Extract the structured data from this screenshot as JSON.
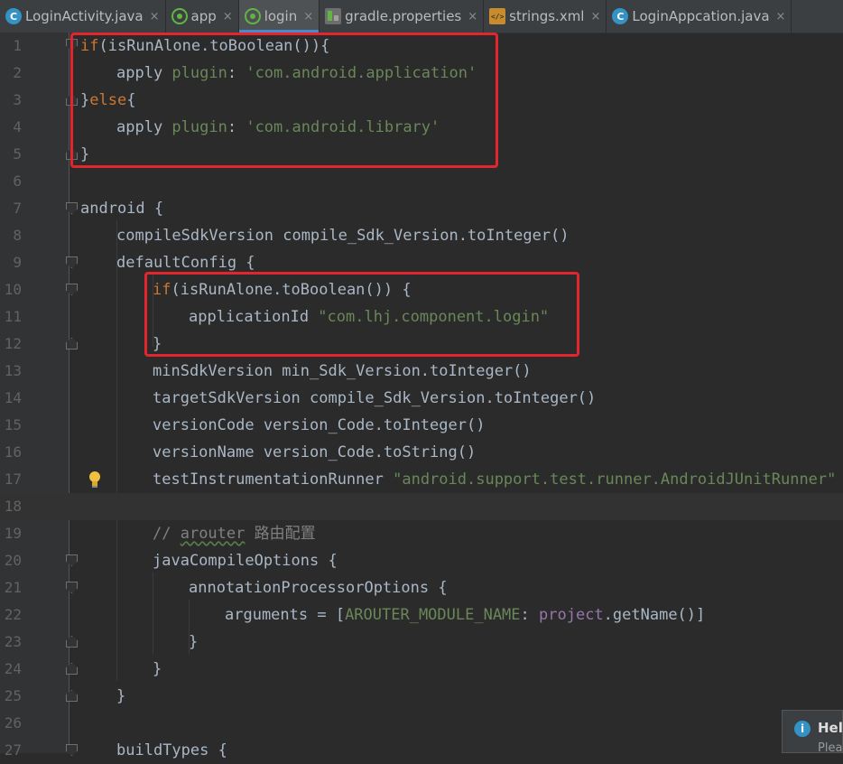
{
  "tabs": [
    {
      "label": "LoginActivity.java",
      "icon": "java-class-icon",
      "active": false
    },
    {
      "label": "app",
      "icon": "gradle-icon",
      "active": false
    },
    {
      "label": "login",
      "icon": "gradle-icon",
      "active": true
    },
    {
      "label": "gradle.properties",
      "icon": "properties-file-icon",
      "active": false
    },
    {
      "label": "strings.xml",
      "icon": "xml-file-icon",
      "active": false
    },
    {
      "label": "LoginAppcation.java",
      "icon": "java-class-icon",
      "active": false
    }
  ],
  "tab_close_glyph": "×",
  "line_numbers": [
    "1",
    "2",
    "3",
    "4",
    "5",
    "6",
    "7",
    "8",
    "9",
    "10",
    "11",
    "12",
    "13",
    "14",
    "15",
    "16",
    "17",
    "18",
    "19",
    "20",
    "21",
    "22",
    "23",
    "24",
    "25",
    "26",
    "27"
  ],
  "code": {
    "l1": {
      "kw_if": "if",
      "rest": "(isRunAlone.toBoolean()){"
    },
    "l2": {
      "a": "apply ",
      "b": "plugin",
      "c": ": ",
      "d": "'com.android.application'"
    },
    "l3": {
      "a": "}",
      "kw": "else",
      "b": "{"
    },
    "l4": {
      "a": "apply ",
      "b": "plugin",
      "c": ": ",
      "d": "'com.android.library'"
    },
    "l5": {
      "a": "}"
    },
    "l7": {
      "a": "android {"
    },
    "l8": {
      "a": "compileSdkVersion compile_Sdk_Version.toInteger()"
    },
    "l9": {
      "a": "defaultConfig {"
    },
    "l10": {
      "kw_if": "if",
      "rest": "(isRunAlone.toBoolean()) {"
    },
    "l11": {
      "a": "applicationId ",
      "b": "\"com.lhj.component.login\""
    },
    "l12": {
      "a": "}"
    },
    "l13": {
      "a": "minSdkVersion min_Sdk_Version.toInteger()"
    },
    "l14": {
      "a": "targetSdkVersion compile_Sdk_Version.toInteger()"
    },
    "l15": {
      "a": "versionCode version_Code.toInteger()"
    },
    "l16": {
      "a": "versionName version_Code.toString()"
    },
    "l17": {
      "a": "testInstrumentationRunner ",
      "b": "\"android.support.test.runner.AndroidJUnitRunner\""
    },
    "l19": {
      "a": "// ",
      "b": "arouter",
      "c": " 路由配置"
    },
    "l20": {
      "a": "javaCompileOptions {"
    },
    "l21": {
      "a": "annotationProcessorOptions {"
    },
    "l22": {
      "a": "arguments = [",
      "b": "AROUTER_MODULE_NAME",
      "c": ": ",
      "d": "project",
      "e": ".getName()]"
    },
    "l23": {
      "a": "}"
    },
    "l24": {
      "a": "}"
    },
    "l25": {
      "a": "}"
    },
    "l27": {
      "a": "buildTypes {"
    }
  },
  "toast": {
    "title": "Help",
    "body": "Plea"
  },
  "colors": {
    "highlight_box": "#e3262d",
    "keyword": "#cc7832",
    "string": "#6a8759",
    "comment": "#808080"
  }
}
